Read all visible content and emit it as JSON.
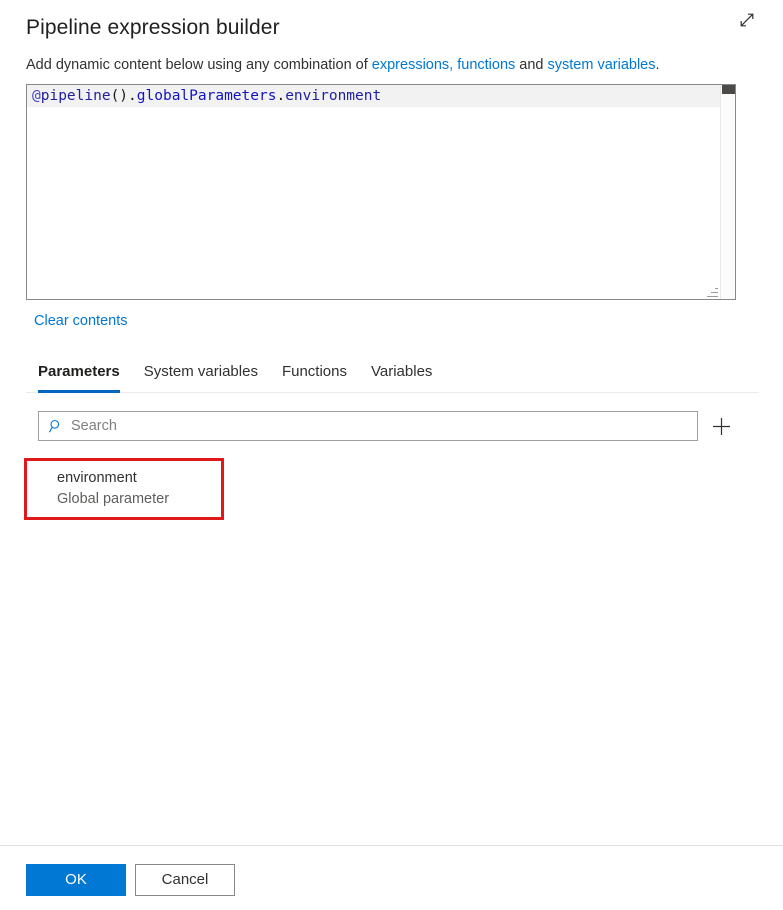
{
  "header": {
    "title": "Pipeline expression builder",
    "expand_icon": "expand-diagonal-icon"
  },
  "subtitle": {
    "prefix": "Add dynamic content below using any combination of ",
    "link1": "expressions, functions",
    "middle": " and ",
    "link2": "system variables",
    "suffix": "."
  },
  "editor": {
    "expression": "@pipeline().globalParameters.environment",
    "tokens": {
      "at": "@",
      "fn": "pipeline",
      "parens": "().",
      "prop": "globalParameters",
      "dot": ".",
      "tail": "environment"
    }
  },
  "clear_contents_label": "Clear contents",
  "tabs": [
    {
      "label": "Parameters",
      "active": true
    },
    {
      "label": "System variables",
      "active": false
    },
    {
      "label": "Functions",
      "active": false
    },
    {
      "label": "Variables",
      "active": false
    }
  ],
  "search": {
    "placeholder": "Search",
    "value": "",
    "icon": "search-icon",
    "add_icon": "plus-icon"
  },
  "parameters": [
    {
      "name": "environment",
      "subtitle": "Global parameter",
      "highlighted": true
    }
  ],
  "footer": {
    "ok_label": "OK",
    "cancel_label": "Cancel"
  },
  "colors": {
    "accent": "#0078d4",
    "tab_underline": "#0067c0",
    "highlight_red": "#e01a1a",
    "link": "#0078d4",
    "expr_blue": "#1313c4",
    "expr_at": "#4a43c8"
  }
}
